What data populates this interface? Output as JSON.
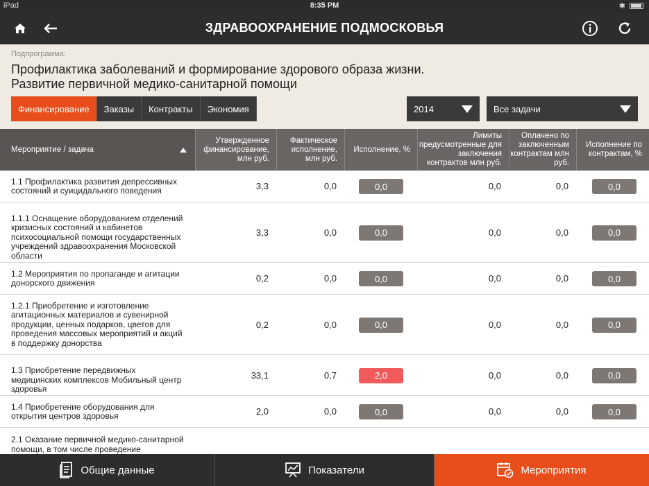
{
  "status": {
    "device": "iPad",
    "time": "8:35 PM"
  },
  "header": {
    "title": "ЗДРАВООХРАНЕНИЕ ПОДМОСКОВЬЯ"
  },
  "subprogram": {
    "label": "Подпрограмма:",
    "title_line1": "Профилактика заболеваний и формирование здорового образа жизни.",
    "title_line2": "Развитие первичной медико-санитарной помощи"
  },
  "tabs": [
    "Финансирование",
    "Заказы",
    "Контракты",
    "Экономия"
  ],
  "filters": {
    "year": "2014",
    "tasks": "Все задачи"
  },
  "columns": {
    "name": "Мероприятие / задача",
    "approved": "Утвержденное финансирование, млн руб.",
    "actual": "Фактическое исполнение, млн руб.",
    "exec_pct": "Исполнение, %",
    "limits": "Лимиты предусмотренные для заключения контрактов млн руб.",
    "paid": "Оплачено по заключенным контрактам млн руб.",
    "contract_pct": "Исполнение по контрактам, %"
  },
  "rows": [
    {
      "name": "1.1 Профилактика развития депрессивных состояний и суицидального поведения",
      "approved": "3,3",
      "actual": "0,0",
      "exec_pct": "0,0",
      "limits": "0,0",
      "paid": "0,0",
      "contract_pct": "0,0"
    },
    {
      "name": "1.1.1 Оснащение оборудованием отделений кризисных состояний и кабинетов психосоциальной помощи государственных учреждений здравоохранения Московской области",
      "approved": "3,3",
      "actual": "0,0",
      "exec_pct": "0,0",
      "limits": "0,0",
      "paid": "0,0",
      "contract_pct": "0,0"
    },
    {
      "name": "1.2 Мероприятия по пропаганде и агитации донорского движения",
      "approved": "0,2",
      "actual": "0,0",
      "exec_pct": "0,0",
      "limits": "0,0",
      "paid": "0,0",
      "contract_pct": "0,0"
    },
    {
      "name": "1.2.1 Приобретение и изготовление агитационных материалов и сувенирной продукции, ценных подарков, цветов для проведения массовых мероприятий и акций в поддержку донорства",
      "approved": "0,2",
      "actual": "0,0",
      "exec_pct": "0,0",
      "limits": "0,0",
      "paid": "0,0",
      "contract_pct": "0,0"
    },
    {
      "name": "1.3 Приобретение передвижных медицинских комплексов Мобильный центр здоровья",
      "approved": "33,1",
      "actual": "0,7",
      "exec_pct": "2,0",
      "limits": "0,0",
      "paid": "0,0",
      "contract_pct": "0,0",
      "exec_highlight": "#f15b5b"
    },
    {
      "name": "1.4 Приобретение оборудования для открытия центров здоровья",
      "approved": "2,0",
      "actual": "0,0",
      "exec_pct": "0,0",
      "limits": "0,0",
      "paid": "0,0",
      "contract_pct": "0,0"
    },
    {
      "name": "2.1 Оказание первичной медико-санитарной помощи, в том числе проведение",
      "approved": "",
      "actual": "",
      "exec_pct": "",
      "limits": "",
      "paid": "",
      "contract_pct": ""
    }
  ],
  "bottom_nav": [
    "Общие данные",
    "Показатели",
    "Мероприятия"
  ],
  "colors": {
    "accent": "#e84e1b",
    "dark": "#2d2d2d",
    "pill": "#7e7874",
    "pill_alert": "#f15b5b"
  }
}
